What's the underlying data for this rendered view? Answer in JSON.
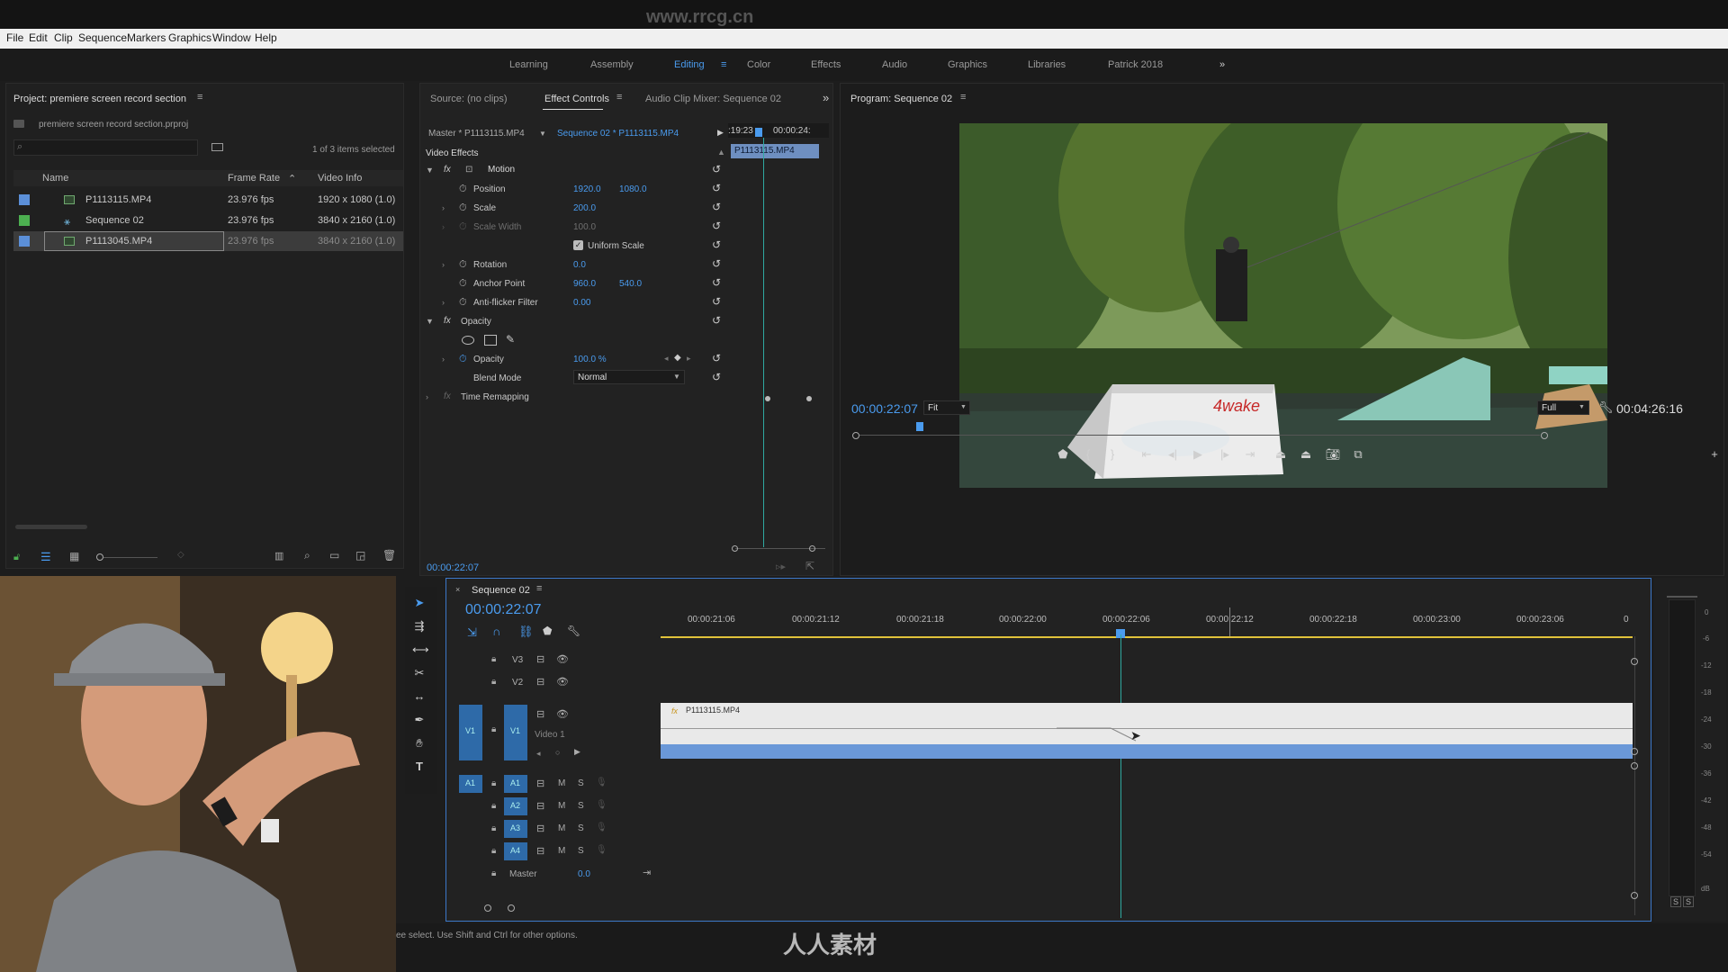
{
  "app": {
    "watermark_url": "www.rrcg.cn",
    "watermark_brand": "人人素材"
  },
  "menu": [
    "File",
    "Edit",
    "Clip",
    "Sequence",
    "Markers",
    "Graphics",
    "Window",
    "Help"
  ],
  "workspaces": [
    "Learning",
    "Assembly",
    "Editing",
    "Color",
    "Effects",
    "Audio",
    "Graphics",
    "Libraries",
    "Patrick 2018"
  ],
  "workspace_overflow": "»",
  "project": {
    "title": "Project: premiere screen record section",
    "path": "premiere screen record section.prproj",
    "selection": "1 of 3 items selected",
    "columns": [
      "Name",
      "Frame Rate",
      "Video Info"
    ],
    "items": [
      {
        "name": "P1113115.MP4",
        "fps": "23.976 fps",
        "info": "1920 x 1080 (1.0)",
        "color": "#5b8fd8"
      },
      {
        "name": "Sequence 02",
        "fps": "23.976 fps",
        "info": "3840 x 2160 (1.0)",
        "color": "#4caf50"
      },
      {
        "name": "P1113045.MP4",
        "fps": "23.976 fps",
        "info": "3840 x 2160 (1.0)",
        "color": "#5b8fd8"
      }
    ]
  },
  "effects": {
    "tab_source": "Source: (no clips)",
    "tab_active": "Effect Controls",
    "tab_mixer": "Audio Clip Mixer: Sequence 02",
    "master": "Master * P1113115.MP4",
    "sequence": "Sequence 02 * P1113115.MP4",
    "time_start": ":19:23",
    "time_end": "00:00:24:",
    "clip_label": "P1113115.MP4",
    "video_effects": "Video Effects",
    "motion": "Motion",
    "position_label": "Position",
    "position_x": "1920.0",
    "position_y": "1080.0",
    "scale_label": "Scale",
    "scale_val": "200.0",
    "scale_width_label": "Scale Width",
    "scale_width_val": "100.0",
    "uniform": "Uniform Scale",
    "rotation_label": "Rotation",
    "rotation_val": "0.0",
    "anchor_label": "Anchor Point",
    "anchor_x": "960.0",
    "anchor_y": "540.0",
    "antiflicker_label": "Anti-flicker Filter",
    "antiflicker_val": "0.00",
    "opacity_group": "Opacity",
    "opacity_label": "Opacity",
    "opacity_val": "100.0 %",
    "blend_label": "Blend Mode",
    "blend_val": "Normal",
    "time_remap": "Time Remapping",
    "timecode": "00:00:22:07"
  },
  "program": {
    "title": "Program: Sequence 02",
    "timecode": "00:00:22:07",
    "fit": "Fit",
    "full": "Full",
    "duration": "00:04:26:16"
  },
  "timeline": {
    "tab": "Sequence 02",
    "timecode": "00:00:22:07",
    "ruler": [
      "00:00:21:06",
      "00:00:21:12",
      "00:00:21:18",
      "00:00:22:00",
      "00:00:22:06",
      "00:00:22:12",
      "00:00:22:18",
      "00:00:23:00",
      "00:00:23:06",
      "0"
    ],
    "video_tracks": [
      "V3",
      "V2",
      "V1"
    ],
    "video1_name": "Video 1",
    "v1_src": "V1",
    "audio_tracks": [
      "A1",
      "A2",
      "A3",
      "A4"
    ],
    "a1_src": "A1",
    "master": "Master",
    "master_val": "0.0",
    "clip_name": "P1113115.MP4",
    "fx": "fx",
    "mute": "M",
    "solo": "S"
  },
  "meter": {
    "labels": [
      "0",
      "-6",
      "-12",
      "-18",
      "-24",
      "-30",
      "-36",
      "-42",
      "-48",
      "-54",
      "dB"
    ],
    "solo": "S"
  },
  "status": "ee select. Use Shift and Ctrl for other options.",
  "chart_colors": {
    "accent_blue": "#4a9bee",
    "clip_blue": "#6a98d8",
    "playhead": "#2fa9a0"
  }
}
